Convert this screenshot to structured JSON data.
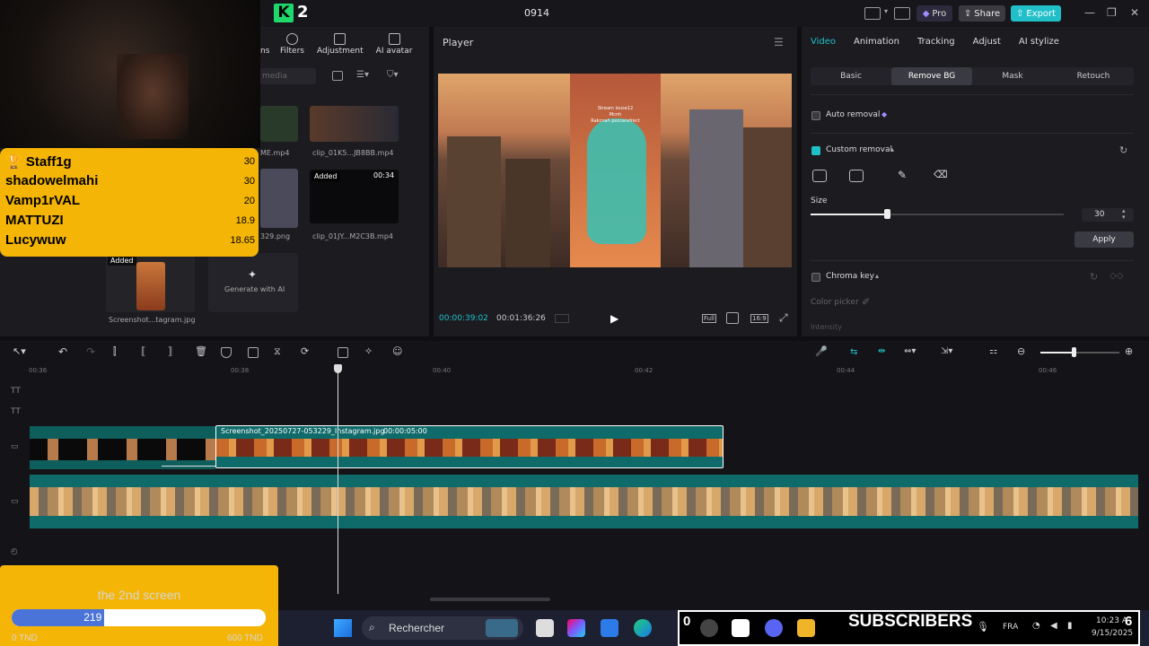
{
  "window": {
    "app_number": "2",
    "project_name": "0914"
  },
  "header": {
    "pro_label": "Pro",
    "share_label": "Share",
    "export_label": "Export"
  },
  "media": {
    "tabs": [
      {
        "label": "Filters",
        "icon": "filters-icon"
      },
      {
        "label": "Adjustment",
        "icon": "adjustment-icon"
      },
      {
        "label": "AI avatar",
        "icon": "ai-avatar-icon"
      }
    ],
    "tab_partial": "ns",
    "search_placeholder": "media",
    "items": [
      {
        "name": "ME.mp4"
      },
      {
        "name": "clip_01K5...JB8BB.mp4"
      },
      {
        "name": "329.png"
      },
      {
        "name": "clip_01JY...M2C3B.mp4",
        "added": "Added",
        "duration": "00:34"
      },
      {
        "name": "Screenshot...tagram.jpg",
        "added": "Added"
      },
      {
        "name": "Generate with AI"
      }
    ]
  },
  "player": {
    "title": "Player",
    "time_current": "00:00:39:02",
    "time_total": "00:01:36:26",
    "full_label": "Full",
    "ratio_label": "16:9",
    "video_text_line1": "Stream louse12",
    "video_text_line2": "Mcnh",
    "video_text_line3": "Rakcnah poccerefrect"
  },
  "inspector": {
    "tabs": [
      {
        "label": "Video",
        "active": true
      },
      {
        "label": "Animation"
      },
      {
        "label": "Tracking"
      },
      {
        "label": "Adjust"
      },
      {
        "label": "AI stylize"
      }
    ],
    "sub_tabs": [
      {
        "label": "Basic"
      },
      {
        "label": "Remove BG",
        "active": true
      },
      {
        "label": "Mask"
      },
      {
        "label": "Retouch"
      }
    ],
    "auto_removal": "Auto removal",
    "custom_removal": "Custom removal",
    "size_label": "Size",
    "size_value": "30",
    "size_level": 0.3,
    "apply_label": "Apply",
    "chroma_key": "Chroma key",
    "color_picker": "Color picker",
    "intensity": "Intensity"
  },
  "timeline": {
    "ticks": [
      "00:36",
      "00:38",
      "00:40",
      "00:42",
      "00:44",
      "00:46"
    ],
    "clip_title": "Screenshot_20250727-053229_Instagram.jpg",
    "clip_duration": "00:00:05:00"
  },
  "overlays": {
    "leaderboard": [
      {
        "name": "Staff1g",
        "value": "30",
        "trophy": true
      },
      {
        "name": "shadowelmahi",
        "value": "30"
      },
      {
        "name": "Vamp1rVAL",
        "value": "20"
      },
      {
        "name": "MATTUZI",
        "value": "18.9"
      },
      {
        "name": "Lucywuw",
        "value": "18.65"
      }
    ],
    "goal": {
      "title": "the 2nd screen",
      "current": "219",
      "fraction": 0.365,
      "min": "0 TND",
      "max": "600 TND"
    },
    "subscribers": {
      "label": "SUBSCRIBERS",
      "left_count": "0",
      "right_count": "6"
    }
  },
  "taskbar": {
    "search_label": "Rechercher",
    "lang": "FRA",
    "time": "10:23 A",
    "date": "9/15/2025"
  },
  "colors": {
    "accent": "#21c0c8",
    "overlay_yellow": "#f5b506",
    "clip_teal": "#0f6b6a",
    "goal_blue": "#4a74d8"
  }
}
